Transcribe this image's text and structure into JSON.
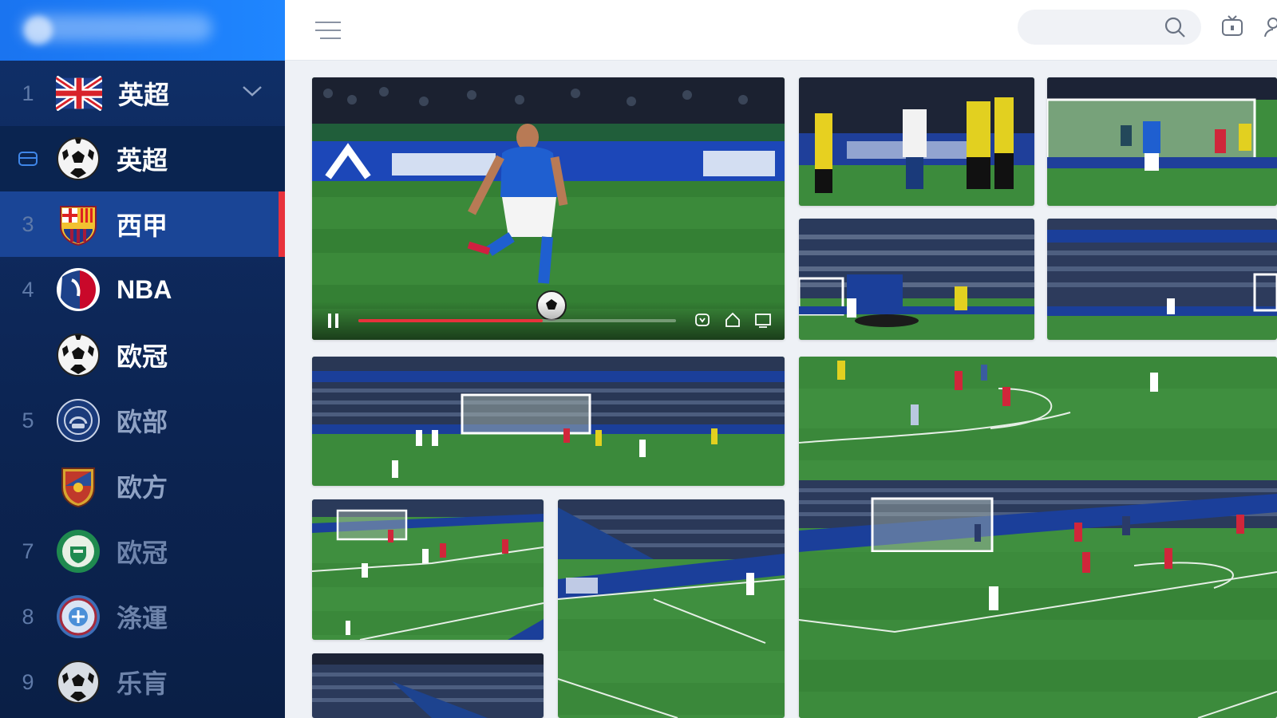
{
  "sidebar": {
    "items": [
      {
        "num": "1",
        "label": "英超",
        "logo": "uk-flag-icon"
      },
      {
        "num": "",
        "label": "英超",
        "logo": "soccer-ball-icon"
      },
      {
        "num": "3",
        "label": "西甲",
        "logo": "barcelona-crest-icon"
      },
      {
        "num": "4",
        "label": "NBA",
        "logo": "nba-logo-icon"
      },
      {
        "num": "",
        "label": "欧冠",
        "logo": "soccer-ball-icon"
      },
      {
        "num": "5",
        "label": "欧部",
        "logo": "europa-crest-icon"
      },
      {
        "num": "",
        "label": "欧方",
        "logo": "shield-crest-icon"
      },
      {
        "num": "7",
        "label": "欧冠",
        "logo": "green-club-crest-icon"
      },
      {
        "num": "8",
        "label": "涤運",
        "logo": "blue-club-crest-icon"
      },
      {
        "num": "9",
        "label": "乐肓",
        "logo": "soccer-ball-icon"
      }
    ]
  },
  "topbar": {
    "search_placeholder": ""
  },
  "player": {
    "progress": 0.58
  },
  "colors": {
    "accent": "#1f86ff",
    "active_marker": "#e8323c",
    "sidebar_bg": "#0c2452"
  }
}
